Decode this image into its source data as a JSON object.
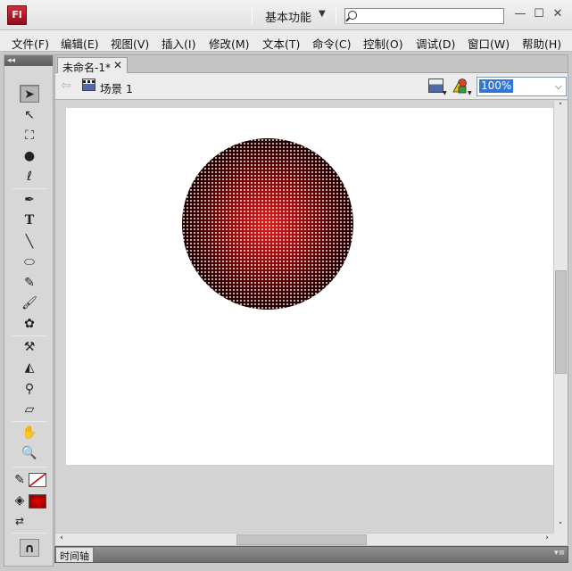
{
  "app": {
    "logo": "Fl",
    "workspace": "基本功能",
    "search_placeholder": "",
    "window_buttons": {
      "minimize": "—",
      "maximize": "☐",
      "close": "✕"
    }
  },
  "menu": [
    "文件(F)",
    "编辑(E)",
    "视图(V)",
    "插入(I)",
    "修改(M)",
    "文本(T)",
    "命令(C)",
    "控制(O)",
    "调试(D)",
    "窗口(W)",
    "帮助(H)"
  ],
  "tools": {
    "selection": "➤",
    "subselection": "↖",
    "free_transform": "⛶",
    "3d_rotation": "●",
    "lasso": "ℓ",
    "pen": "✒",
    "text": "T",
    "line": "╲",
    "oval": "⬭",
    "pencil": "✎",
    "brush": "🖌",
    "deco": "✿",
    "bone": "⚒",
    "paint_bucket": "◭",
    "eyedropper": "⚲",
    "eraser": "▱",
    "hand": "✋",
    "zoom": "🔍",
    "stroke_color_icon": "✎",
    "fill_color_icon": "◈",
    "swap_colors_icon": "⇄",
    "snap_icon": "∩"
  },
  "colors": {
    "fill_swatch": "#c40000",
    "stroke_swatch": "none",
    "accent": "#3375d6"
  },
  "document": {
    "tab_title": "未命名-1*",
    "scene_label": "场景 1",
    "zoom": "100%"
  },
  "panels": {
    "timeline": "时间轴"
  }
}
